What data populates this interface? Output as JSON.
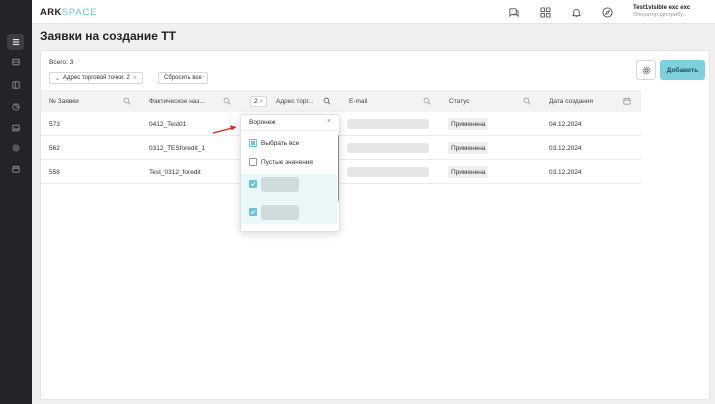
{
  "header": {
    "logo_part1": "ARK",
    "logo_part2": "SPACE",
    "user_name": "Test1visible exc exc",
    "user_role": "Оператор дистрибу..."
  },
  "page": {
    "title": "Заявки на создание ТТ"
  },
  "toolbar": {
    "total_label": "Всего: 3",
    "filter_chip_label": "Адрес торговой точки: 2",
    "reset_label": "Сбросить все",
    "add_label": "Добавить"
  },
  "table": {
    "columns": [
      "№ Заявки",
      "Фактическое наз...",
      "Адрес торг...",
      "E-mail",
      "Статус",
      "Дата создания"
    ],
    "address_filter_count": "2",
    "rows": [
      {
        "number": "573",
        "name": "0412_Test01",
        "status": "Применена",
        "date": "04.12.2024"
      },
      {
        "number": "562",
        "name": "0312_TESforedit_1",
        "status": "Применена",
        "date": "03.12.2024"
      },
      {
        "number": "558",
        "name": "Test_0312_foredit",
        "status": "Применена",
        "date": "03.12.2024"
      }
    ]
  },
  "dropdown": {
    "search_value": "Воронеж",
    "select_all_label": "Выбрать все",
    "empty_values_label": "Пустые значения"
  },
  "colors": {
    "accent": "#7fd0dc",
    "sidebar_bg": "#232428",
    "annotation_arrow": "#e02020"
  }
}
